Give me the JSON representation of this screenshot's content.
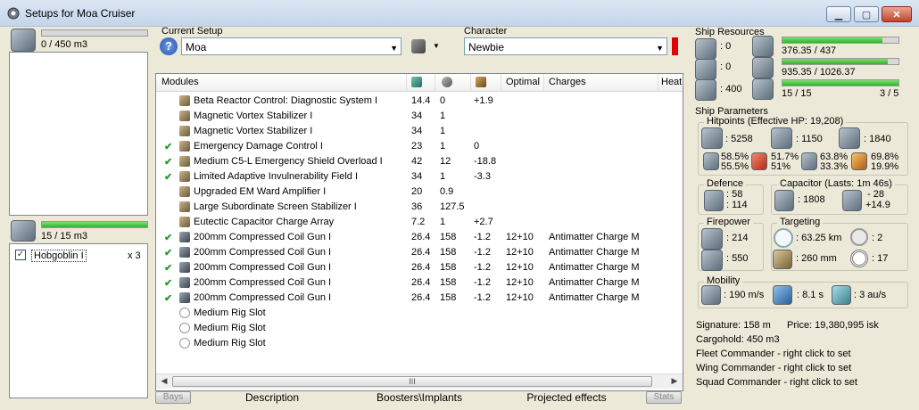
{
  "window": {
    "title": "Setups for Moa Cruiser"
  },
  "cargo": {
    "value": "0 / 450 m3",
    "fill": 0
  },
  "drones": {
    "value": "15 / 15 m3",
    "fill": 1.0,
    "items": [
      {
        "name": "Hobgoblin I",
        "qty": "x 3",
        "checked": true
      }
    ]
  },
  "setup": {
    "label": "Current Setup",
    "value": "Moa"
  },
  "character": {
    "label": "Character",
    "value": "Newbie"
  },
  "modules": {
    "headers": [
      "Modules",
      "",
      "",
      "",
      "Optimal",
      "Charges",
      "Heat"
    ],
    "rows": [
      {
        "check": "",
        "icon": "reactor",
        "name": "Beta Reactor Control: Diagnostic System I",
        "cpu": "14.4",
        "pg": "0",
        "cap": "+1.9",
        "opt": "",
        "charge": ""
      },
      {
        "check": "",
        "icon": "stabilizer",
        "name": "Magnetic Vortex Stabilizer I",
        "cpu": "34",
        "pg": "1",
        "cap": "",
        "opt": "",
        "charge": ""
      },
      {
        "check": "",
        "icon": "stabilizer",
        "name": "Magnetic Vortex Stabilizer I",
        "cpu": "34",
        "pg": "1",
        "cap": "",
        "opt": "",
        "charge": ""
      },
      {
        "check": "✔",
        "icon": "dc",
        "name": "Emergency Damage Control I",
        "cpu": "23",
        "pg": "1",
        "cap": "0",
        "opt": "",
        "charge": ""
      },
      {
        "check": "✔",
        "icon": "shield",
        "name": "Medium C5-L Emergency Shield Overload I",
        "cpu": "42",
        "pg": "12",
        "cap": "-18.8",
        "opt": "",
        "charge": ""
      },
      {
        "check": "✔",
        "icon": "invuln",
        "name": "Limited Adaptive Invulnerability Field I",
        "cpu": "34",
        "pg": "1",
        "cap": "-3.3",
        "opt": "",
        "charge": ""
      },
      {
        "check": "",
        "icon": "ward",
        "name": "Upgraded EM Ward Amplifier I",
        "cpu": "20",
        "pg": "0.9",
        "cap": "",
        "opt": "",
        "charge": ""
      },
      {
        "check": "",
        "icon": "screen",
        "name": "Large Subordinate Screen Stabilizer I",
        "cpu": "36",
        "pg": "127.5",
        "cap": "",
        "opt": "",
        "charge": ""
      },
      {
        "check": "",
        "icon": "capacitor",
        "name": "Eutectic Capacitor Charge Array",
        "cpu": "7.2",
        "pg": "1",
        "cap": "+2.7",
        "opt": "",
        "charge": ""
      },
      {
        "check": "✔",
        "icon": "gun",
        "name": "200mm Compressed Coil Gun I",
        "cpu": "26.4",
        "pg": "158",
        "cap": "-1.2",
        "opt": "12+10",
        "charge": "Antimatter Charge M"
      },
      {
        "check": "✔",
        "icon": "gun",
        "name": "200mm Compressed Coil Gun I",
        "cpu": "26.4",
        "pg": "158",
        "cap": "-1.2",
        "opt": "12+10",
        "charge": "Antimatter Charge M"
      },
      {
        "check": "✔",
        "icon": "gun",
        "name": "200mm Compressed Coil Gun I",
        "cpu": "26.4",
        "pg": "158",
        "cap": "-1.2",
        "opt": "12+10",
        "charge": "Antimatter Charge M"
      },
      {
        "check": "✔",
        "icon": "gun",
        "name": "200mm Compressed Coil Gun I",
        "cpu": "26.4",
        "pg": "158",
        "cap": "-1.2",
        "opt": "12+10",
        "charge": "Antimatter Charge M"
      },
      {
        "check": "✔",
        "icon": "gun",
        "name": "200mm Compressed Coil Gun I",
        "cpu": "26.4",
        "pg": "158",
        "cap": "-1.2",
        "opt": "12+10",
        "charge": "Antimatter Charge M"
      },
      {
        "check": "",
        "icon": "rig",
        "name": "Medium Rig Slot",
        "cpu": "",
        "pg": "",
        "cap": "",
        "opt": "",
        "charge": ""
      },
      {
        "check": "",
        "icon": "rig",
        "name": "Medium Rig Slot",
        "cpu": "",
        "pg": "",
        "cap": "",
        "opt": "",
        "charge": ""
      },
      {
        "check": "",
        "icon": "rig",
        "name": "Medium Rig Slot",
        "cpu": "",
        "pg": "",
        "cap": "",
        "opt": "",
        "charge": ""
      }
    ]
  },
  "scroll": {
    "thumb": "III"
  },
  "tabs": {
    "bays": "Bays",
    "description": "Description",
    "boosters": "Boosters\\Implants",
    "projected": "Projected effects",
    "stats": "Stats"
  },
  "resources": {
    "title": "Ship Resources",
    "turrets": ": 0",
    "launchers": ": 0",
    "calibration": ": 400",
    "cpu": {
      "text": "376.35 / 437",
      "fill": 0.861
    },
    "pg": {
      "text": "935.35 / 1026.37",
      "fill": 0.911
    },
    "drone_bw": {
      "text": "15 / 15",
      "fill": 1.0
    },
    "drones_active": "3 / 5"
  },
  "params": {
    "title": "Ship Parameters",
    "hp_title": "Hitpoints (Effective HP: 19,208)",
    "shield_hp": ": 5258",
    "armor_hp": ": 1150",
    "structure_hp": ": 1840",
    "shield_res": {
      "em_therm": "58.5%",
      "kin_exp": "55.5%"
    },
    "armor_res": {
      "em_therm": "51.7%",
      "kin_exp": "51%"
    },
    "hull_res": {
      "em_therm": "63.8%",
      "kin_exp": "33.3%"
    },
    "other_res": {
      "em_therm": "69.8%",
      "kin_exp": "19.9%"
    },
    "defence_title": "Defence",
    "def_1": ": 58",
    "def_2": ": 114",
    "cap_title": "Capacitor (Lasts: 1m 46s)",
    "cap_amount": ": 1808",
    "cap_delta1": "- 28",
    "cap_delta2": "+14.9",
    "fire_title": "Firepower",
    "dps": ": 214",
    "volley": ": 550",
    "target_title": "Targeting",
    "range": ": 63.25 km",
    "max_targets": ": 2",
    "scan_res": ": 260 mm",
    "sensor": ": 17",
    "mob_title": "Mobility",
    "speed": ": 190 m/s",
    "align": ": 8.1 s",
    "warp": ": 3 au/s"
  },
  "info": {
    "signature": "Signature: 158 m",
    "price": "Price: 19,380,995 isk",
    "cargohold": "Cargohold: 450 m3",
    "fleet": "Fleet Commander - right click to set",
    "wing": "Wing Commander - right click to set",
    "squad": "Squad Commander - right click to set"
  }
}
